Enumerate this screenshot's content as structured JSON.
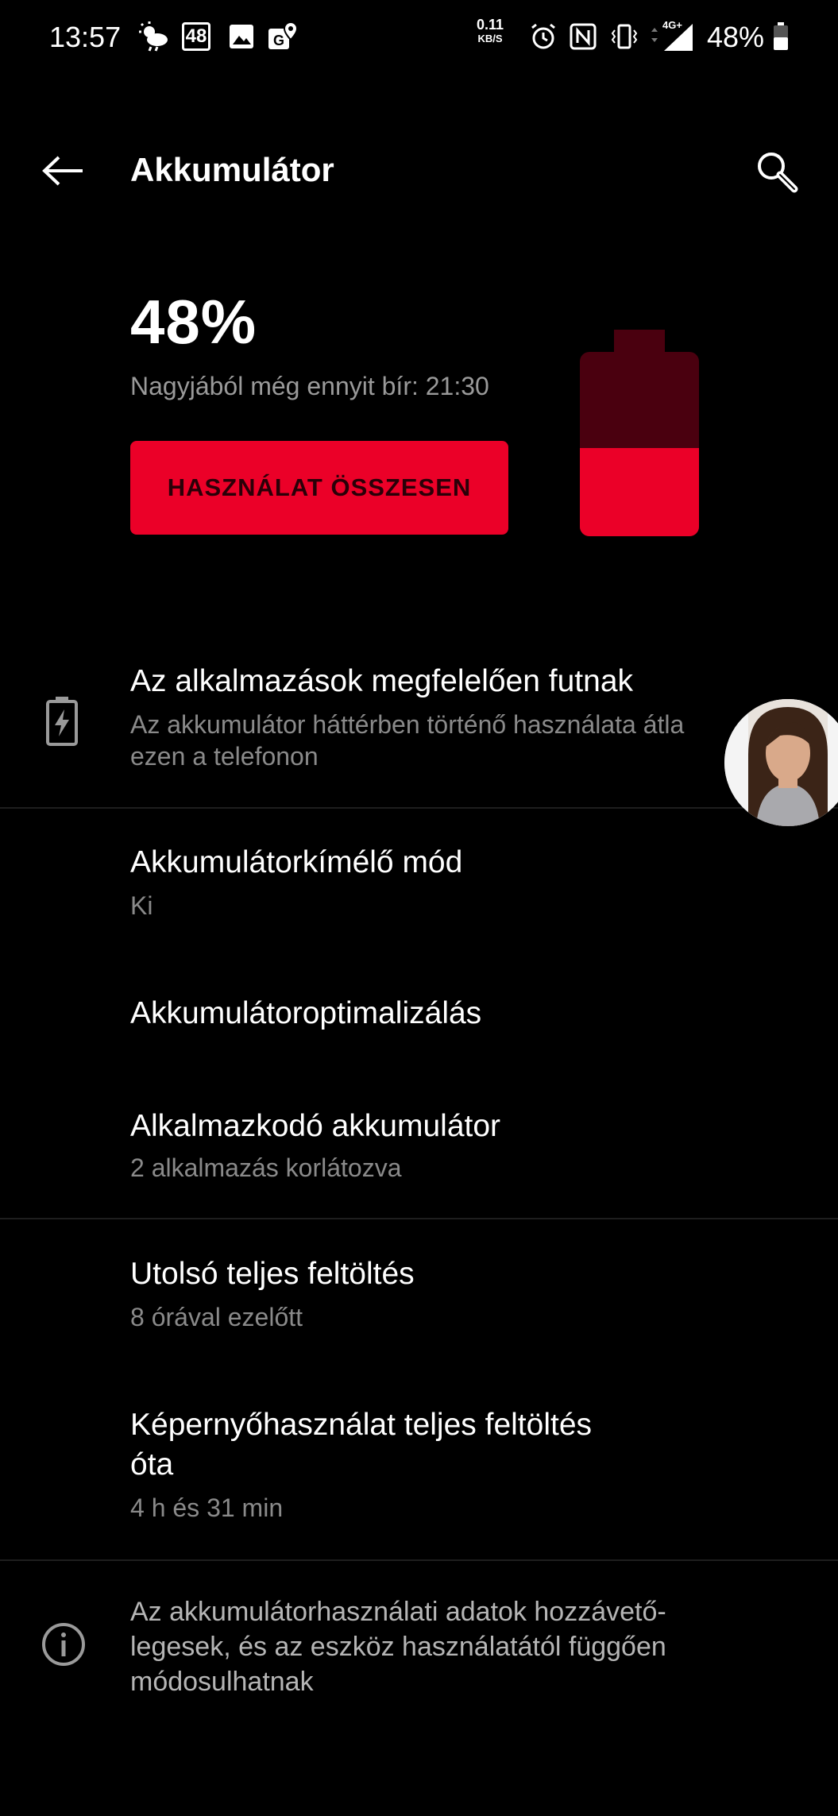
{
  "status_bar": {
    "time": "13:57",
    "badge_number": "48",
    "net_speed_value": "0.11",
    "net_speed_unit": "KB/S",
    "network_type": "4G+",
    "battery_percent": "48%"
  },
  "app_bar": {
    "title": "Akkumulátor"
  },
  "battery": {
    "percent": "48%",
    "level": 0.48,
    "remaining": "Nagyjából még ennyit bír: 21:30",
    "usage_button": "HASZNÁLAT ÖSSZESEN",
    "color_fill": "#eb0028",
    "color_empty": "#4a000f"
  },
  "apps_status": {
    "title": "Az alkalmazások megfelelően futnak",
    "subtitle_line1": "Az akkumulátor háttérben történő használata átla",
    "subtitle_line2": "ezen a telefonon"
  },
  "settings": {
    "saver_title": "Akkumulátorkímélő mód",
    "saver_value": "Ki",
    "optimization_title": "Akkumulátoroptimalizálás",
    "adaptive_title": "Alkalmazkodó akkumulátor",
    "adaptive_value": "2 alkalmazás korlátozva"
  },
  "stats": {
    "last_charge_title": "Utolsó teljes feltöltés",
    "last_charge_value": "8 órával ezelőtt",
    "screen_usage_title_line1": "Képernyőhasználat teljes feltöltés",
    "screen_usage_title_line2": "óta",
    "screen_usage_value": "4 h és 31 min"
  },
  "footer": {
    "info_line1": "Az akkumulátorhasználati adatok hozzávető-",
    "info_line2": "legesek, és az eszköz használatától függően",
    "info_line3": "módosulhatnak"
  }
}
